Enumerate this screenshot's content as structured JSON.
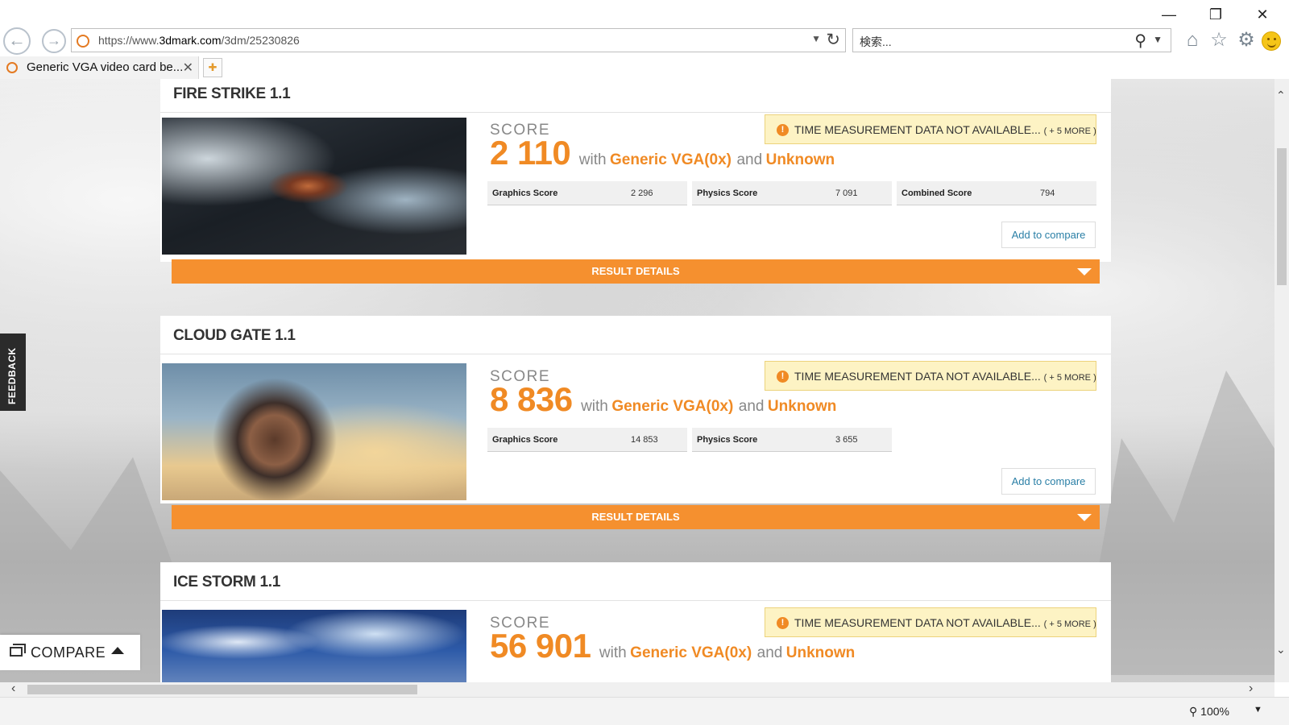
{
  "browser": {
    "url_prefix": "https://www.",
    "url_host": "3dmark.com",
    "url_path": "/3dm/25230826",
    "search_placeholder": "検索...",
    "tab_title": "Generic VGA video card be...",
    "zoom": "100%"
  },
  "sidebar": {
    "feedback_label": "FEEDBACK",
    "compare_label": "COMPARE"
  },
  "common": {
    "score_label": "SCORE",
    "with": "with",
    "gpu": "Generic VGA(0x)",
    "and": "and",
    "cpu": "Unknown",
    "warning": "TIME MEASUREMENT DATA NOT AVAILABLE...",
    "warning_more": "( + 5 MORE )",
    "add_to_compare": "Add to compare",
    "result_details": "RESULT DETAILS"
  },
  "tests": [
    {
      "name": "FIRE STRIKE 1.1",
      "score": "2 110",
      "subscores": [
        {
          "label": "Graphics Score",
          "value": "2 296"
        },
        {
          "label": "Physics Score",
          "value": "7 091"
        },
        {
          "label": "Combined Score",
          "value": "794"
        }
      ]
    },
    {
      "name": "CLOUD GATE 1.1",
      "score": "8 836",
      "subscores": [
        {
          "label": "Graphics Score",
          "value": "14 853"
        },
        {
          "label": "Physics Score",
          "value": "3 655"
        }
      ]
    },
    {
      "name": "ICE STORM 1.1",
      "score": "56 901"
    }
  ]
}
